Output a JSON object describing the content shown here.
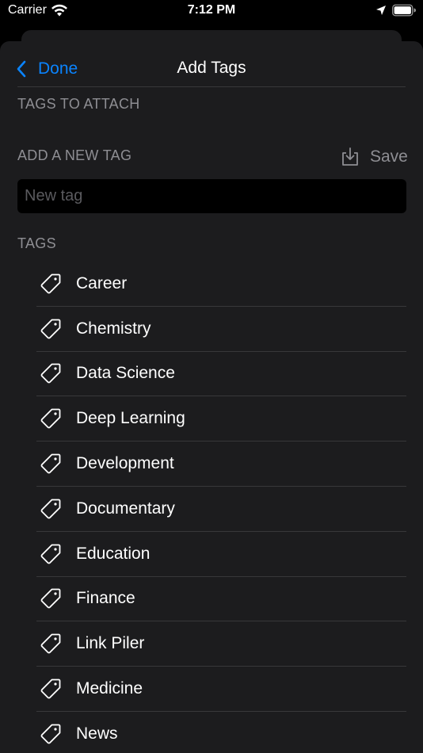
{
  "status_bar": {
    "carrier": "Carrier",
    "time": "7:12 PM"
  },
  "nav": {
    "back_label": "Done",
    "title": "Add Tags"
  },
  "sections": {
    "attach_header": "TAGS TO ATTACH",
    "new_tag_header": "ADD A NEW TAG",
    "save_label": "Save",
    "tags_header": "TAGS"
  },
  "new_tag_input": {
    "placeholder": "New tag",
    "value": ""
  },
  "tags": [
    {
      "label": "Career"
    },
    {
      "label": "Chemistry"
    },
    {
      "label": "Data Science"
    },
    {
      "label": "Deep Learning"
    },
    {
      "label": "Development"
    },
    {
      "label": "Documentary"
    },
    {
      "label": "Education"
    },
    {
      "label": "Finance"
    },
    {
      "label": "Link Piler"
    },
    {
      "label": "Medicine"
    },
    {
      "label": "News"
    }
  ],
  "colors": {
    "accent": "#0a84ff",
    "sheet_bg": "#1c1c1e",
    "secondary_text": "#8e8e93"
  }
}
